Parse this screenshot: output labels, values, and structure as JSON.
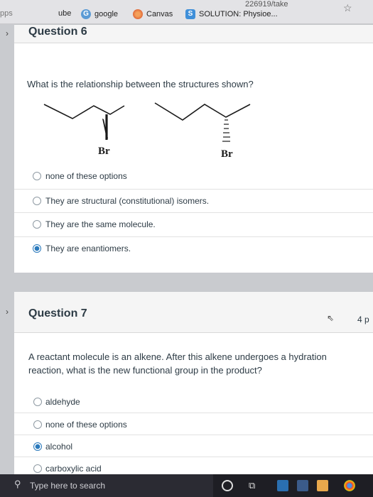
{
  "browser": {
    "url_fragment": "226919/take",
    "left_fragment": "pps",
    "bookmarks": [
      {
        "label": "ube"
      },
      {
        "label": "google"
      },
      {
        "label": "Canvas"
      },
      {
        "label": "SOLUTION: Physioe..."
      }
    ]
  },
  "q6": {
    "title": "Question 6",
    "text": "What is the relationship between the structures shown?",
    "structure_left_label": "Br",
    "structure_right_label": "Br",
    "answers": [
      {
        "label": "none of these options",
        "selected": false
      },
      {
        "label": "They are structural (constitutional) isomers.",
        "selected": false
      },
      {
        "label": "They are the same molecule.",
        "selected": false
      },
      {
        "label": "They are enantiomers.",
        "selected": true
      }
    ]
  },
  "q7": {
    "title": "Question 7",
    "points": "4 p",
    "text": "A reactant molecule is an alkene. After this alkene undergoes a hydration reaction, what is the new functional group in the product?",
    "answers": [
      {
        "label": "aldehyde",
        "selected": false
      },
      {
        "label": "none of these options",
        "selected": false
      },
      {
        "label": "alcohol",
        "selected": true
      },
      {
        "label": "carboxylic acid",
        "selected": false
      }
    ]
  },
  "taskbar": {
    "search_placeholder": "Type here to search"
  }
}
